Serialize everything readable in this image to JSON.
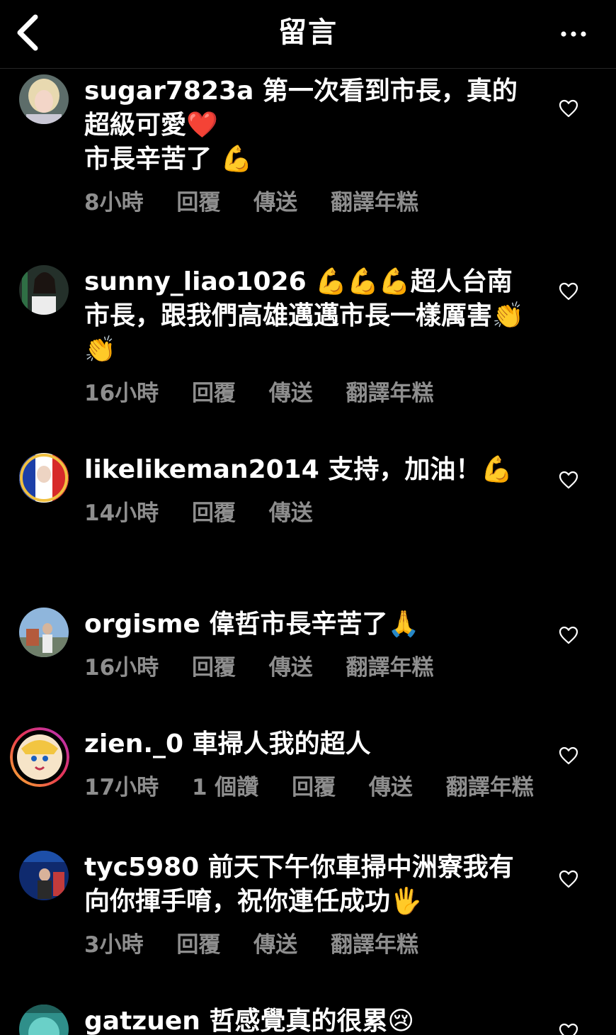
{
  "header": {
    "title": "留言"
  },
  "comments": [
    {
      "username": "sugar7823a",
      "text": "第一次看到市長，真的超級可愛❤️\n市長辛苦了 💪",
      "time": "8小時",
      "likes": "",
      "reply": "回覆",
      "send": "傳送",
      "translate": "翻譯年糕"
    },
    {
      "username": "sunny_liao1026",
      "text": "💪💪💪超人台南市長，跟我們高雄邁邁市長一樣厲害👏👏",
      "time": "16小時",
      "likes": "",
      "reply": "回覆",
      "send": "傳送",
      "translate": "翻譯年糕"
    },
    {
      "username": "likelikeman2014",
      "text": "支持，加油！💪",
      "time": "14小時",
      "likes": "",
      "reply": "回覆",
      "send": "傳送",
      "translate": ""
    },
    {
      "username": "orgisme",
      "text": "偉哲市長辛苦了🙏",
      "time": "16小時",
      "likes": "",
      "reply": "回覆",
      "send": "傳送",
      "translate": "翻譯年糕"
    },
    {
      "username": "zien._0",
      "text": "車掃人我的超人",
      "time": "17小時",
      "likes": "1 個讚",
      "reply": "回覆",
      "send": "傳送",
      "translate": "翻譯年糕"
    },
    {
      "username": "tyc5980",
      "text": "前天下午你車掃中洲寮我有向你揮手唷，祝你連任成功🖐️",
      "time": "3小時",
      "likes": "",
      "reply": "回覆",
      "send": "傳送",
      "translate": "翻譯年糕"
    },
    {
      "username": "gatzuen",
      "text": "哲感覺真的很累😢",
      "time": "",
      "likes": "",
      "reply": "",
      "send": "",
      "translate": ""
    }
  ],
  "icons": {
    "back": "chevron-left-icon",
    "more": "more-horizontal-icon",
    "like": "heart-outline-icon"
  },
  "colors": {
    "background": "#000000",
    "text": "#ffffff",
    "secondary": "#8e8e8e",
    "divider": "#262626"
  }
}
